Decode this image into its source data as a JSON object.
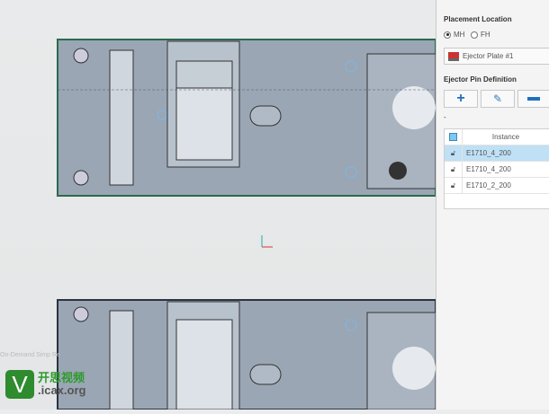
{
  "panel": {
    "placement_label": "Placement Location",
    "radio_mh": "MH",
    "radio_fh": "FH",
    "selected_radio": "MH",
    "plate_select": "Ejector Plate #1",
    "ejector_label": "Ejector Pin Definition",
    "dash": "-",
    "table": {
      "header": "Instance",
      "rows": [
        {
          "name": "E1710_4_200",
          "selected": true
        },
        {
          "name": "E1710_4_200",
          "selected": false
        },
        {
          "name": "E1710_2_200",
          "selected": false
        }
      ]
    }
  },
  "viewport": {
    "status_text": "On-Demand Simp Re"
  },
  "watermark": {
    "letter": "V",
    "cn": "开思视频",
    "site": ".icax.org"
  },
  "colors": {
    "part": "#9aa6b4",
    "selected_row": "#bfe0f5",
    "accent": "#1f6fc0"
  }
}
